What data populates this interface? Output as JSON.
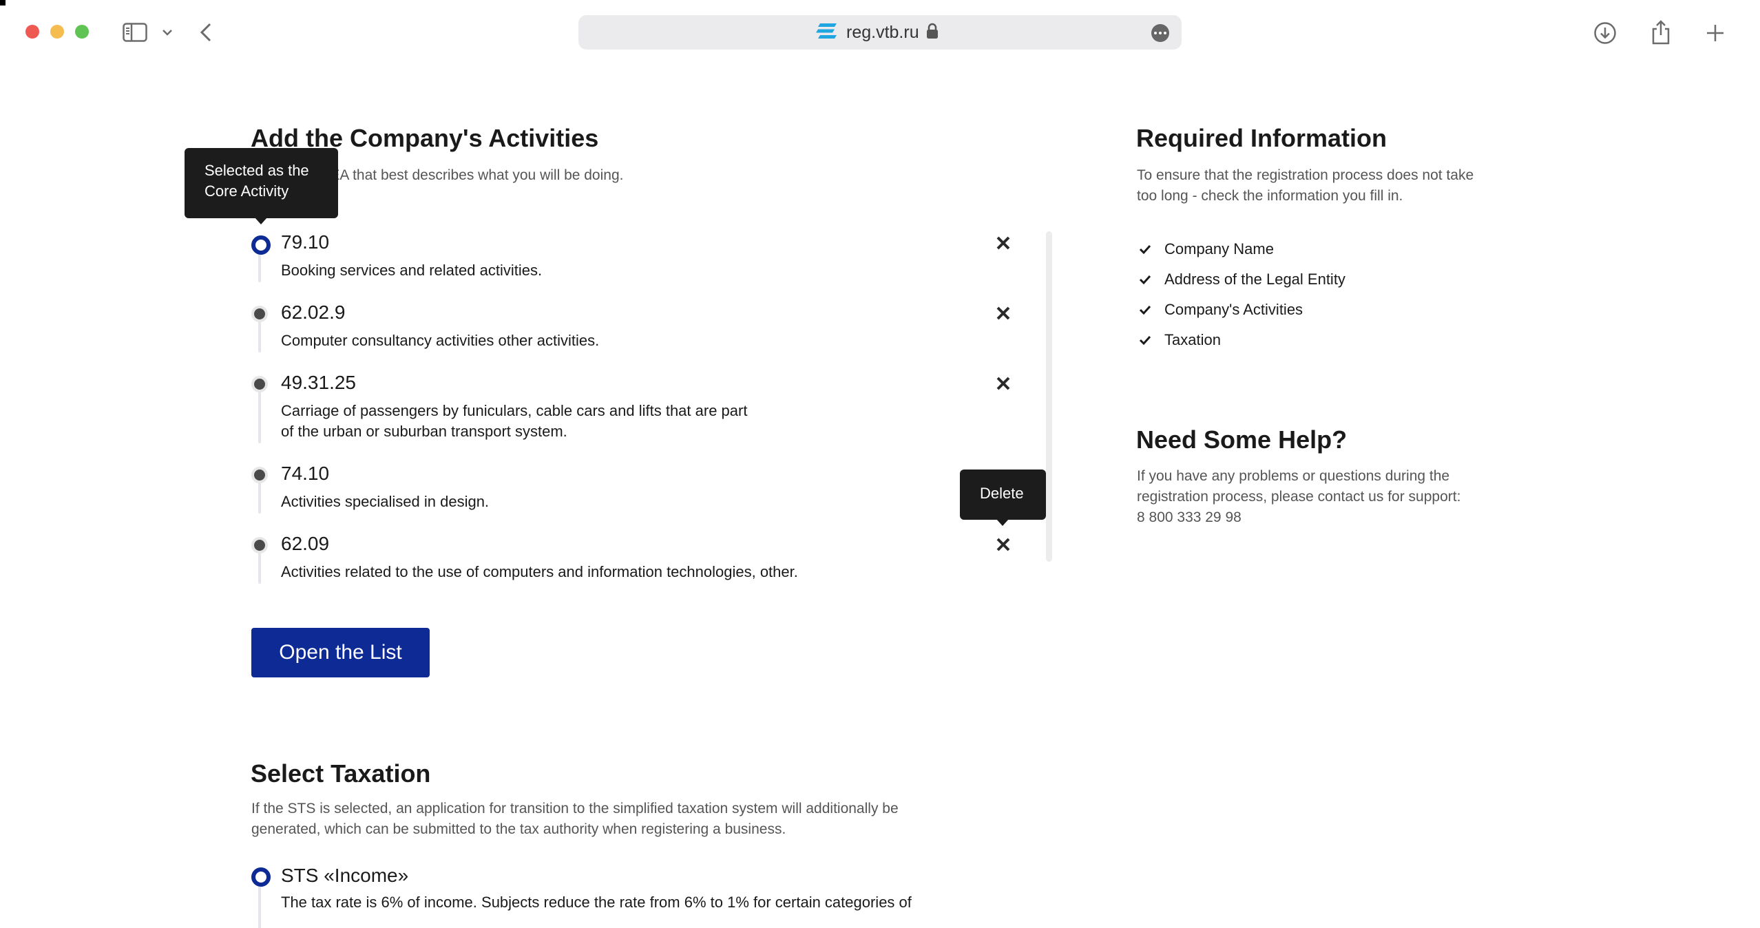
{
  "browser": {
    "url": "reg.vtb.ru"
  },
  "activities": {
    "title": "Add the Company's Activities",
    "subtitle": "Select the CEA that best describes what you will be doing.",
    "items": [
      {
        "code": "79.10",
        "desc": [
          "Booking services and related activities."
        ],
        "core": true
      },
      {
        "code": "62.02.9",
        "desc": [
          "Computer consultancy activities other activities."
        ],
        "core": false
      },
      {
        "code": "49.31.25",
        "desc": [
          "Carriage of passengers by funiculars, cable cars and lifts that are part",
          "of the urban or suburban transport system."
        ],
        "core": false
      },
      {
        "code": "74.10",
        "desc": [
          "Activities specialised in design."
        ],
        "core": false
      },
      {
        "code": "62.09",
        "desc": [
          "Activities related to the use of computers and information technologies, other."
        ],
        "core": false
      }
    ],
    "tooltip_core": [
      "Selected as the",
      "Core Activity"
    ],
    "tooltip_delete": "Delete",
    "open_button": "Open the List"
  },
  "taxation": {
    "title": "Select Taxation",
    "desc": [
      "If the STS is selected, an application for transition to the simplified taxation system will additionally be",
      "generated, which can be submitted to the tax authority when registering a business."
    ],
    "option": {
      "name": "STS «Income»",
      "desc": "The tax rate is 6% of income. Subjects reduce the rate from 6% to 1% for certain categories of"
    }
  },
  "required": {
    "title": "Required Information",
    "desc": [
      "To ensure that the registration process does not take",
      "too long - check the information you fill in."
    ],
    "items": [
      "Company Name",
      "Address of the Legal Entity",
      "Company's Activities",
      "Taxation"
    ]
  },
  "help": {
    "title": "Need Some Help?",
    "desc": [
      "If you have any problems or questions during the",
      "registration process, please contact us for support:"
    ],
    "phone": "8 800 333 29 98"
  },
  "colors": {
    "primary": "#0d2a95",
    "tooltip": "#1c1c1c",
    "vtb_logo": "#1fa6e0"
  }
}
